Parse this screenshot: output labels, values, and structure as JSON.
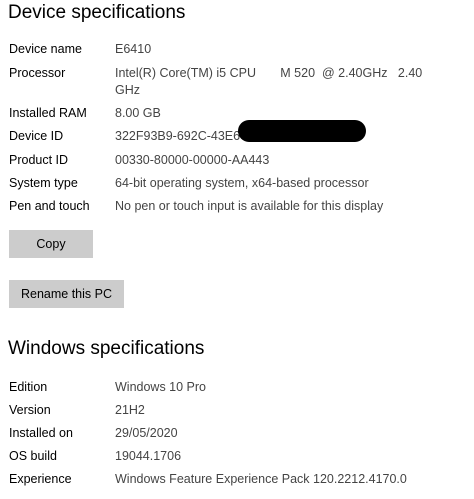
{
  "device": {
    "title": "Device specifications",
    "rows": [
      {
        "label": "Device name",
        "value": "E6410"
      },
      {
        "label": "Processor",
        "value": "Intel(R) Core(TM) i5 CPU       M 520  @ 2.40GHz   2.40 GHz"
      },
      {
        "label": "Installed RAM",
        "value": "8.00 GB"
      },
      {
        "label": "Device ID",
        "value": "322F93B9-692C-43E6-"
      },
      {
        "label": "Product ID",
        "value": "00330-80000-00000-AA443"
      },
      {
        "label": "System type",
        "value": "64-bit operating system, x64-based processor"
      },
      {
        "label": "Pen and touch",
        "value": "No pen or touch input is available for this display"
      }
    ],
    "copy_label": "Copy",
    "rename_label": "Rename this PC"
  },
  "windows": {
    "title": "Windows specifications",
    "rows": [
      {
        "label": "Edition",
        "value": "Windows 10 Pro"
      },
      {
        "label": "Version",
        "value": "21H2"
      },
      {
        "label": "Installed on",
        "value": "29/05/2020"
      },
      {
        "label": "OS build",
        "value": "19044.1706"
      },
      {
        "label": "Experience",
        "value": "Windows Feature Experience Pack 120.2212.4170.0"
      }
    ]
  },
  "colors": {
    "button_bg": "#cccccc",
    "value_text": "#444444",
    "redaction": "#000000"
  }
}
